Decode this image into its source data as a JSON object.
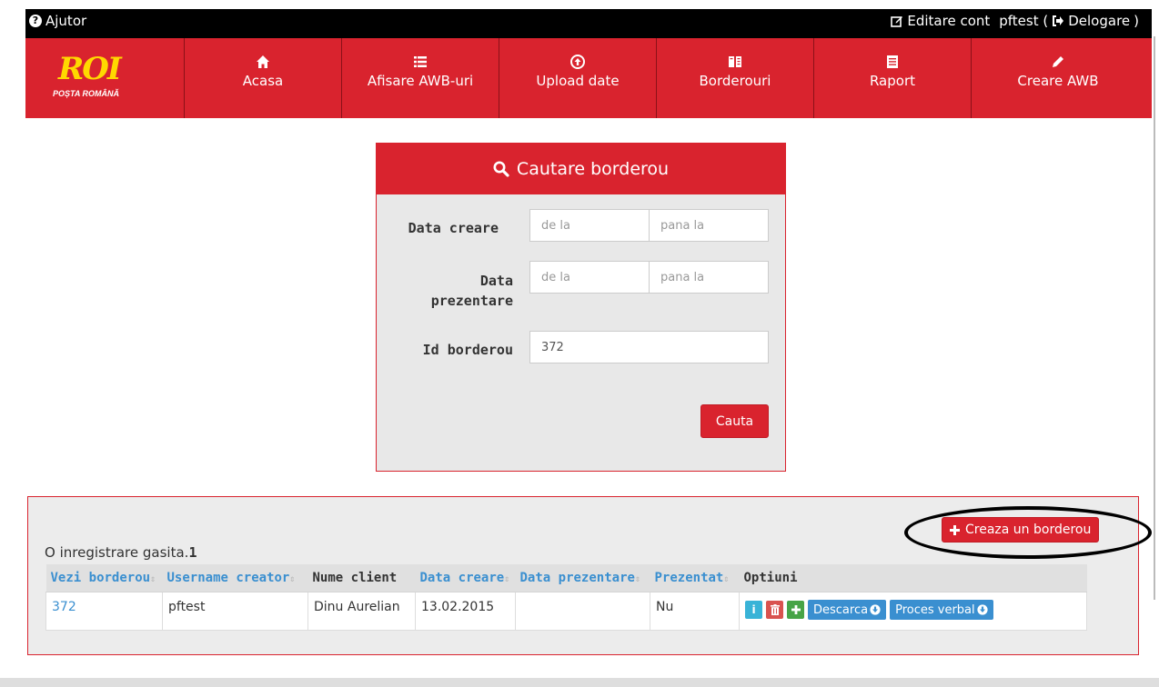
{
  "topbar": {
    "help": "Ajutor",
    "edit_account": "Editare cont",
    "user_prefix": "pftest (",
    "logout": "Delogare",
    "user_suffix": ")"
  },
  "logo": {
    "mark": "ROI",
    "sub": "POȘTA ROMÂNĂ"
  },
  "nav": [
    {
      "label": "Acasa",
      "icon": "home-icon"
    },
    {
      "label": "Afisare AWB-uri",
      "icon": "list-icon"
    },
    {
      "label": "Upload date",
      "icon": "upload-icon"
    },
    {
      "label": "Borderouri",
      "icon": "book-icon"
    },
    {
      "label": "Raport",
      "icon": "report-icon"
    },
    {
      "label": "Creare AWB",
      "icon": "pencil-icon"
    }
  ],
  "search": {
    "title": "Cautare borderou",
    "data_creare_label": "Data creare",
    "data_prezentare_label": "Data prezentare",
    "id_label": "Id borderou",
    "from_placeholder": "de la",
    "to_placeholder": "pana la",
    "id_value": "372",
    "submit": "Cauta"
  },
  "results": {
    "found_text": "O inregistrare gasita.",
    "found_count": "1",
    "create_button": "Creaza un borderou",
    "headers": [
      "Vezi borderou",
      "Username creator",
      "Nume client",
      "Data creare",
      "Data prezentare",
      "Prezentat",
      "Optiuni"
    ],
    "rows": [
      {
        "id": "372",
        "username": "pftest",
        "client": "Dinu Aurelian",
        "data_creare": "13.02.2015",
        "data_prezentare": "",
        "prezentat": "Nu",
        "download": "Descarca",
        "proces_verbal": "Proces verbal"
      }
    ]
  },
  "colors": {
    "brand_red": "#d9232e",
    "link_blue": "#3a8fd0",
    "logo_yellow": "#ffd800"
  }
}
